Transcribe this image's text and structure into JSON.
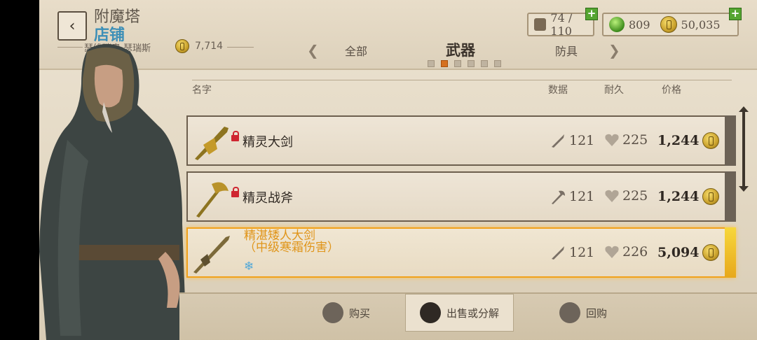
{
  "header": {
    "title": "附魔塔",
    "subtitle": "店铺",
    "merchant_name": "瑟维瑞奥·瑟瑞斯",
    "merchant_gold": "7,714",
    "inventory": "74 / 110",
    "gems": "809",
    "gold": "50,035"
  },
  "tabs": {
    "all": "全部",
    "weapons": "武器",
    "armor": "防具"
  },
  "columns": {
    "name": "名字",
    "data": "数据",
    "durability": "耐久",
    "price": "价格"
  },
  "items": [
    {
      "name": "精灵大剑",
      "damage": "121",
      "durability": "225",
      "price": "1,244",
      "locked": true,
      "icon": "greatsword-icon"
    },
    {
      "name": "精灵战斧",
      "damage": "121",
      "durability": "225",
      "price": "1,244",
      "locked": true,
      "icon": "battleaxe-icon"
    },
    {
      "name": "精湛矮人大剑",
      "enchant": "（中级寒霜伤害）",
      "damage": "121",
      "durability": "226",
      "price": "5,094",
      "locked": false,
      "selected": true,
      "icon": "dwarven-greatsword-icon"
    }
  ],
  "actions": {
    "buy": "购买",
    "sell": "出售或分解",
    "buyback": "回购"
  },
  "colors": {
    "accent_orange": "#d5701f",
    "enchant_gold": "#e0951a",
    "subtitle_blue": "#3d8fb7",
    "lock_red": "#cf2631"
  }
}
